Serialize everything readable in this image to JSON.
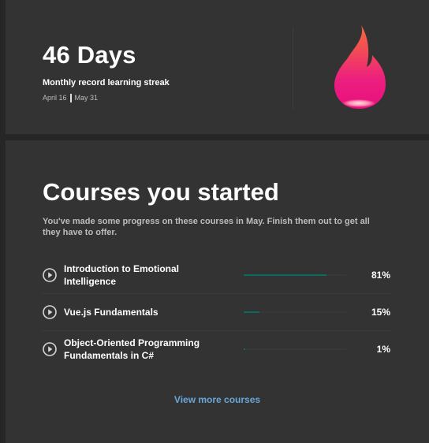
{
  "streak": {
    "days": "46 Days",
    "subtitle": "Monthly record learning streak",
    "start_date": "April 16",
    "end_date": "May 31",
    "icon": "flame-icon"
  },
  "courses": {
    "title": "Courses you started",
    "description": "You've made some progress on these courses in May. Finish them out to get all they have to offer.",
    "items": [
      {
        "title": "Introduction to Emotional Intelligence",
        "progress_label": "81%",
        "progress": 0.81
      },
      {
        "title": "Vue.js Fundamentals",
        "progress_label": "15%",
        "progress": 0.15
      },
      {
        "title": "Object-Oriented Programming Fundamentals in C#",
        "progress_label": "1%",
        "progress": 0.01
      }
    ],
    "view_more": "View more courses"
  },
  "colors": {
    "background": "#262626",
    "card": "#333333",
    "progress": "#0a6b60",
    "link": "#6aa7da"
  }
}
